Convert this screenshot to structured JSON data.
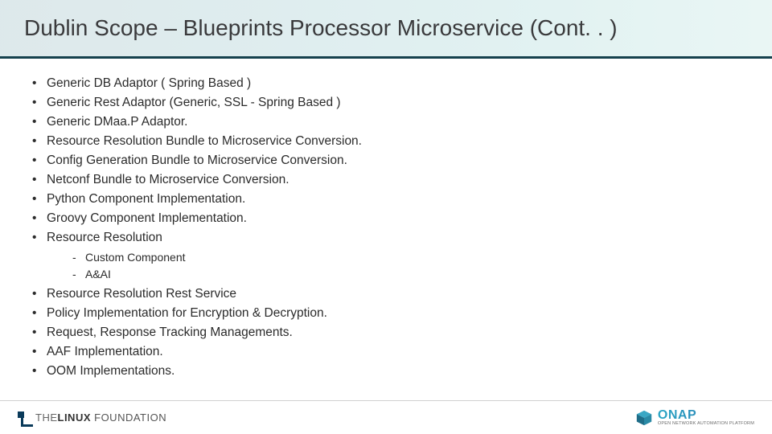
{
  "title": "Dublin Scope – Blueprints Processor Microservice (Cont. . )",
  "bullets_a": [
    "Generic DB Adaptor ( Spring Based )",
    "Generic Rest Adaptor (Generic, SSL - Spring Based )",
    "Generic DMaa.P Adaptor.",
    "Resource Resolution Bundle to Microservice Conversion.",
    "Config Generation Bundle to Microservice Conversion.",
    "Netconf Bundle to Microservice Conversion.",
    "Python Component Implementation.",
    "Groovy Component Implementation.",
    "Resource Resolution"
  ],
  "sub_bullets": [
    "Custom Component",
    "A&AI"
  ],
  "bullets_b": [
    "Resource Resolution Rest Service",
    "Policy Implementation for Encryption & Decryption.",
    "Request, Response Tracking Managements.",
    "AAF Implementation.",
    "OOM Implementations."
  ],
  "footer": {
    "lf_the": "THE",
    "lf_linux": "LINUX",
    "lf_foundation": "FOUNDATION",
    "onap_name": "ONAP",
    "onap_tagline": "OPEN NETWORK AUTOMATION PLATFORM"
  }
}
